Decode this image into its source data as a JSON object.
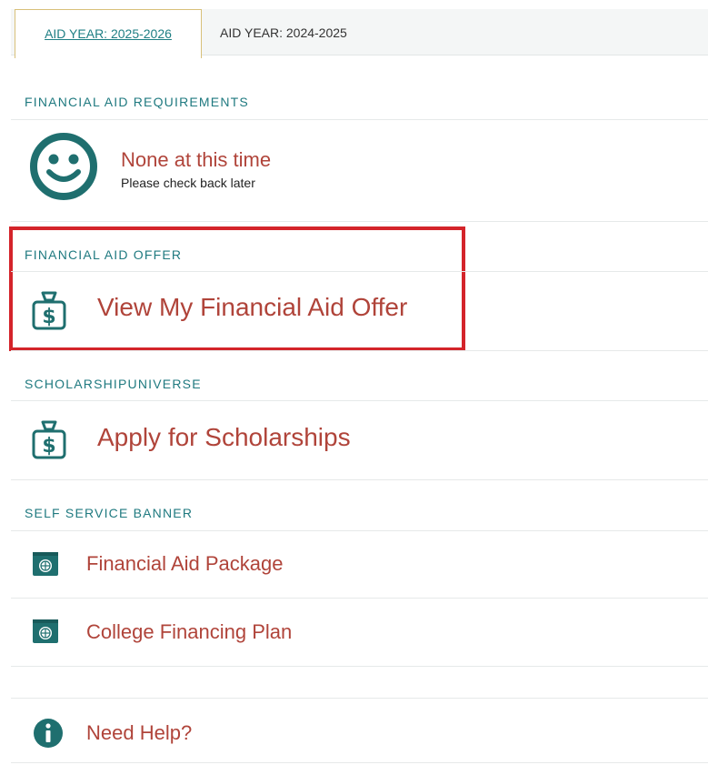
{
  "tabs": [
    {
      "label": "AID YEAR: 2025-2026",
      "active": true
    },
    {
      "label": "AID YEAR: 2024-2025",
      "active": false
    }
  ],
  "requirements": {
    "heading": "FINANCIAL AID REQUIREMENTS",
    "status_title": "None at this time",
    "status_subtitle": "Please check back later",
    "icon": "smiley-icon"
  },
  "offer": {
    "heading": "FINANCIAL AID OFFER",
    "link_label": "View My Financial Aid Offer",
    "icon": "money-bag-icon"
  },
  "scholarship": {
    "heading": "SCHOLARSHIPUNIVERSE",
    "link_label": "Apply for Scholarships",
    "icon": "money-bag-icon"
  },
  "self_service": {
    "heading": "SELF SERVICE BANNER",
    "items": [
      {
        "label": "Financial Aid Package",
        "icon": "globe-window-icon"
      },
      {
        "label": "College Financing Plan",
        "icon": "globe-window-icon"
      }
    ]
  },
  "help": {
    "label": "Need Help?",
    "icon": "info-icon"
  },
  "colors": {
    "accent_teal": "#1f6f6f",
    "link_red": "#b0443a",
    "highlight_red": "#d4242a",
    "active_tab_border": "#d8c07a"
  }
}
